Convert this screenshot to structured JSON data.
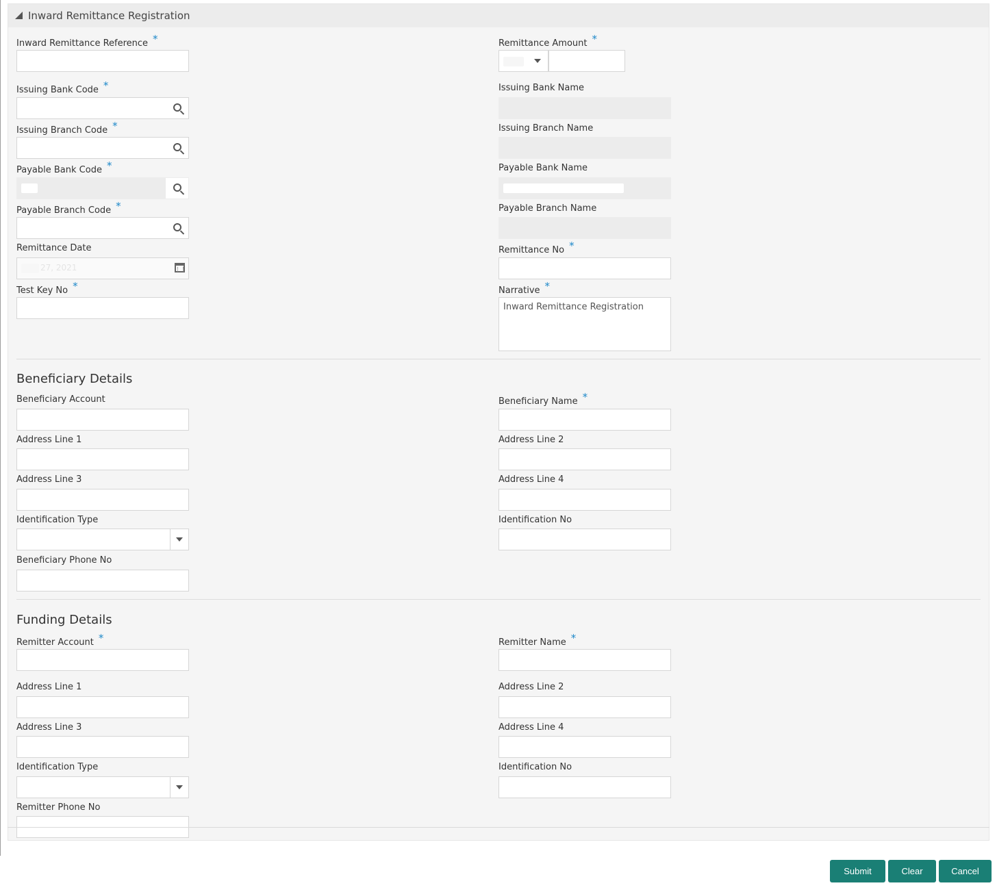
{
  "panel": {
    "title": "Inward Remittance Registration"
  },
  "main": {
    "inward_remittance_reference": {
      "label": "Inward Remittance Reference",
      "required": "*",
      "value": ""
    },
    "remittance_amount": {
      "label": "Remittance Amount",
      "required": "*",
      "currency": "",
      "value": ""
    },
    "issuing_bank_code": {
      "label": "Issuing Bank Code",
      "required": "*",
      "value": ""
    },
    "issuing_bank_name": {
      "label": "Issuing Bank Name",
      "value": ""
    },
    "issuing_branch_code": {
      "label": "Issuing Branch Code",
      "required": "*",
      "value": ""
    },
    "issuing_branch_name": {
      "label": "Issuing Branch Name",
      "value": ""
    },
    "payable_bank_code": {
      "label": "Payable Bank Code",
      "required": "*",
      "value": ""
    },
    "payable_bank_name": {
      "label": "Payable Bank Name",
      "value": ""
    },
    "payable_branch_code": {
      "label": "Payable Branch Code",
      "required": "*",
      "value": ""
    },
    "payable_branch_name": {
      "label": "Payable Branch Name",
      "value": ""
    },
    "remittance_date": {
      "label": "Remittance Date",
      "value": "27, 2021"
    },
    "remittance_no": {
      "label": "Remittance No",
      "required": "*",
      "value": ""
    },
    "test_key_no": {
      "label": "Test Key No",
      "required": "*",
      "value": ""
    },
    "narrative": {
      "label": "Narrative",
      "required": "*",
      "value": "Inward Remittance Registration"
    }
  },
  "beneficiary": {
    "title": "Beneficiary Details",
    "account": {
      "label": "Beneficiary Account",
      "value": ""
    },
    "name": {
      "label": "Beneficiary Name",
      "required": "*",
      "value": ""
    },
    "address1": {
      "label": "Address Line 1",
      "value": ""
    },
    "address2": {
      "label": "Address Line 2",
      "value": ""
    },
    "address3": {
      "label": "Address Line 3",
      "value": ""
    },
    "address4": {
      "label": "Address Line 4",
      "value": ""
    },
    "id_type": {
      "label": "Identification Type",
      "value": ""
    },
    "id_no": {
      "label": "Identification No",
      "value": ""
    },
    "phone": {
      "label": "Beneficiary Phone No",
      "value": ""
    }
  },
  "funding": {
    "title": "Funding Details",
    "account": {
      "label": "Remitter Account",
      "required": "*",
      "value": ""
    },
    "name": {
      "label": "Remitter Name",
      "required": "*",
      "value": ""
    },
    "address1": {
      "label": "Address Line 1",
      "value": ""
    },
    "address2": {
      "label": "Address Line 2",
      "value": ""
    },
    "address3": {
      "label": "Address Line 3",
      "value": ""
    },
    "address4": {
      "label": "Address Line 4",
      "value": ""
    },
    "id_type": {
      "label": "Identification Type",
      "value": ""
    },
    "id_no": {
      "label": "Identification No",
      "value": ""
    },
    "phone": {
      "label": "Remitter Phone No",
      "value": ""
    }
  },
  "actions": {
    "submit": "Submit",
    "clear": "Clear",
    "cancel": "Cancel"
  },
  "colors": {
    "accent": "#1a7f75",
    "required": "#1e88c9",
    "panel_bg": "#f5f5f5",
    "readonly_bg": "#ececec"
  }
}
